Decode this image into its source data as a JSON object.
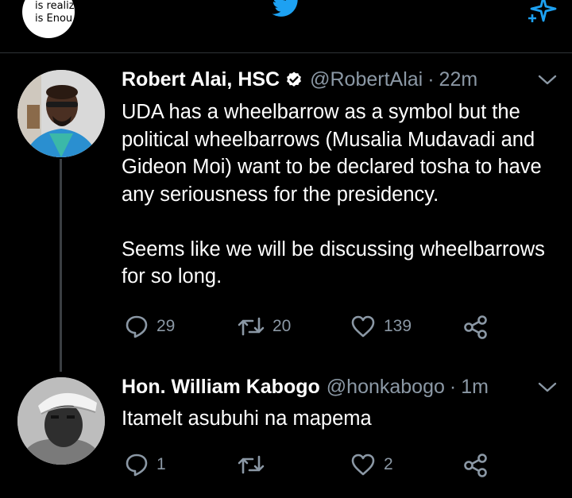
{
  "header": {
    "avatar_text_line1": "is realizi",
    "avatar_text_line2": "is Enou",
    "logo_icon": "twitter-bird-icon",
    "sparkle_icon": "sparkle-icon"
  },
  "colors": {
    "background": "#000000",
    "text": "#ffffff",
    "muted": "#8b98a5",
    "accent": "#1da1f2"
  },
  "tweets": [
    {
      "name": "Robert Alai, HSC",
      "verified": true,
      "handle": "@RobertAlai",
      "separator": "·",
      "time": "22m",
      "text": "UDA has a wheelbarrow as a symbol but the political wheelbarrows (Musalia Mudavadi and Gideon Moi) want to be declared tosha to have any seriousness for the presidency.\n\nSeems like we will be discussing wheelbarrows for so long.",
      "replies": "29",
      "retweets": "20",
      "likes": "139"
    },
    {
      "name": "Hon. William Kabogo",
      "handle": "@honkabogo",
      "separator": "·",
      "time": "1m",
      "text": "Itamelt asubuhi na mapema",
      "replies": "1",
      "retweets": "",
      "likes": "2"
    }
  ]
}
